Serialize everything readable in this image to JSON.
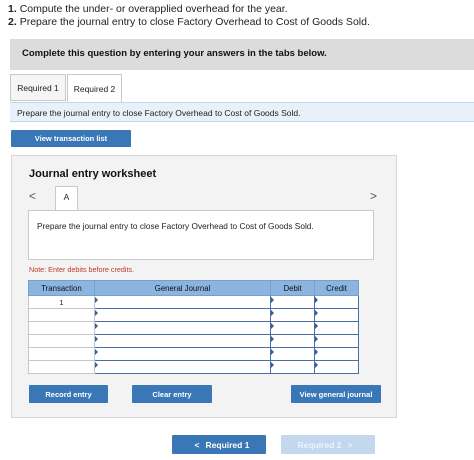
{
  "instructions": {
    "items": [
      {
        "num": "1.",
        "text": "Compute the under- or overapplied overhead for the year."
      },
      {
        "num": "2.",
        "text": "Prepare the journal entry to close Factory Overhead to Cost of Goods Sold."
      }
    ]
  },
  "banner": {
    "text": "Complete this question by entering your answers in the tabs below."
  },
  "tabs": [
    {
      "label": "Required 1",
      "active": false
    },
    {
      "label": "Required 2",
      "active": true
    }
  ],
  "prompt": {
    "text": "Prepare the journal entry to close Factory Overhead to Cost of Goods Sold."
  },
  "buttons": {
    "view_transaction_list": "View transaction list",
    "record_entry": "Record entry",
    "clear_entry": "Clear entry",
    "view_general_journal": "View general journal"
  },
  "worksheet": {
    "title": "Journal entry worksheet",
    "nav_prev": "<",
    "nav_next": ">",
    "entry_tab": "A",
    "description": "Prepare the journal entry to close Factory Overhead to Cost of Goods Sold.",
    "note": "Note: Enter debits before credits."
  },
  "journal_table": {
    "headers": [
      "Transaction",
      "General Journal",
      "Debit",
      "Credit"
    ],
    "rows": [
      {
        "transaction": "1",
        "general_journal": "",
        "debit": "",
        "credit": ""
      },
      {
        "transaction": "",
        "general_journal": "",
        "debit": "",
        "credit": ""
      },
      {
        "transaction": "",
        "general_journal": "",
        "debit": "",
        "credit": ""
      },
      {
        "transaction": "",
        "general_journal": "",
        "debit": "",
        "credit": ""
      },
      {
        "transaction": "",
        "general_journal": "",
        "debit": "",
        "credit": ""
      },
      {
        "transaction": "",
        "general_journal": "",
        "debit": "",
        "credit": ""
      }
    ]
  },
  "bottom_nav": {
    "prev_label": "Required 1",
    "prev_icon": "chevron-left-icon",
    "next_label": "Required 2",
    "next_icon": "chevron-right-icon",
    "prev_arrow": "<",
    "next_arrow": ">"
  },
  "colors": {
    "primary_button": "#3a77b7",
    "table_header": "#8cb4e0",
    "note_text": "#c0392b",
    "prompt_bar": "#e8f1fa",
    "disabled_button": "#c3d7ee"
  }
}
